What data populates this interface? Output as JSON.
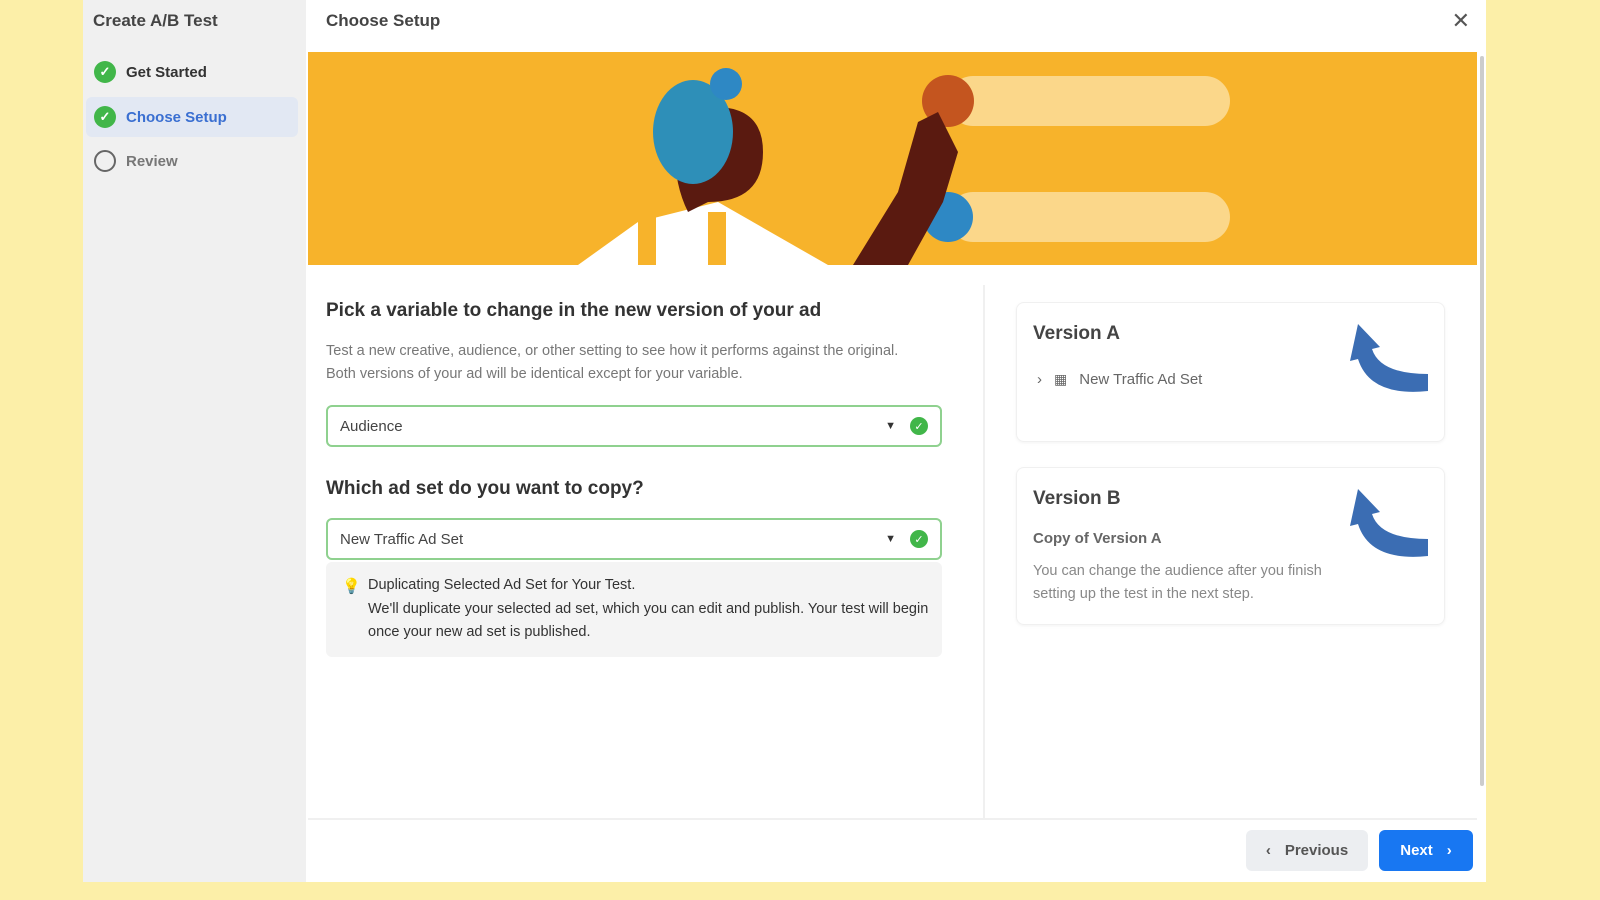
{
  "sidebar": {
    "title": "Create A/B Test",
    "steps": [
      {
        "label": "Get Started",
        "state": "complete"
      },
      {
        "label": "Choose Setup",
        "state": "active"
      },
      {
        "label": "Review",
        "state": "pending"
      }
    ]
  },
  "header": {
    "title": "Choose Setup",
    "close_icon": "close-icon"
  },
  "variable": {
    "heading": "Pick a variable to change in the new version of your ad",
    "description": "Test a new creative, audience, or other setting to see how it performs against the original. Both versions of your ad will be identical except for your variable.",
    "selected": "Audience"
  },
  "adset": {
    "heading": "Which ad set do you want to copy?",
    "selected": "New Traffic Ad Set",
    "info_title": "Duplicating Selected Ad Set for Your Test.",
    "info_body": "We'll duplicate your selected ad set, which you can edit and publish. Your test will begin once your new ad set is published."
  },
  "version_a": {
    "title": "Version A",
    "item": "New Traffic Ad Set"
  },
  "version_b": {
    "title": "Version B",
    "subtitle": "Copy of Version A",
    "body": "You can change the audience after you finish setting up the test in the next step."
  },
  "footer": {
    "previous": "Previous",
    "next": "Next"
  },
  "colors": {
    "accent": "#1877f2",
    "success": "#41b649",
    "banner": "#f7b32b"
  }
}
